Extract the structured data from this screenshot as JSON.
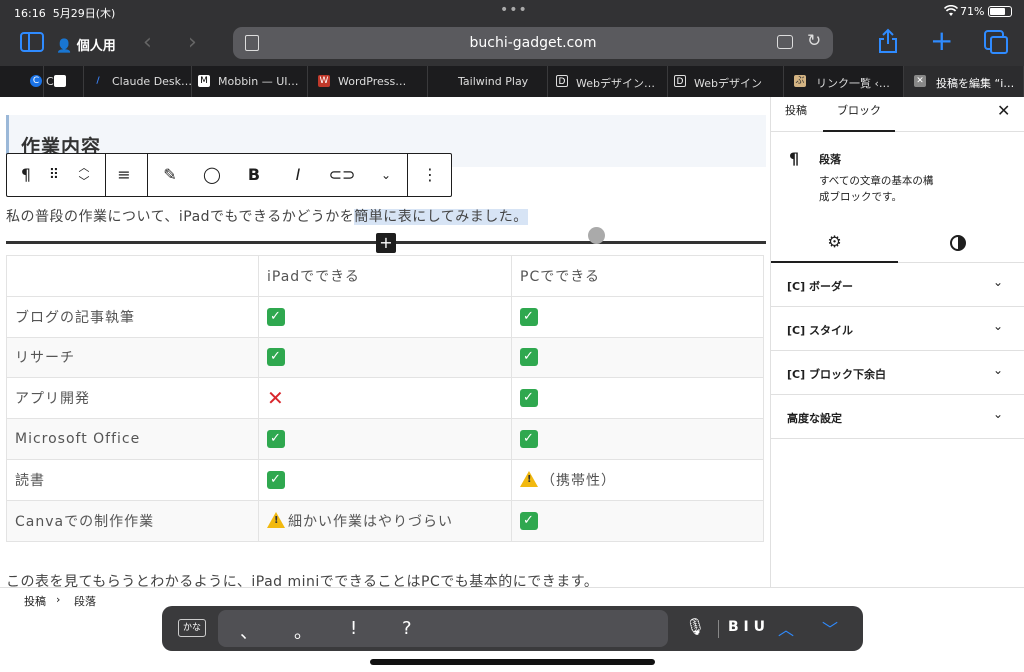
{
  "status": {
    "time": "16:16",
    "date": "5月29日(木)",
    "battery": "71%"
  },
  "toolbar": {
    "profile": "個人用",
    "url": "buchi-gadget.com"
  },
  "tabs": [
    {
      "label": "C",
      "fav": "C",
      "fav_color": "#1a73e8"
    },
    {
      "label": "",
      "fav": "",
      "fav_color": "#ffffff"
    },
    {
      "label": "Claude Desk…",
      "fav": "/",
      "fav_color": "#3b82f6"
    },
    {
      "label": "Mobbin — UI…",
      "fav": "M",
      "fav_color": "#ffffff"
    },
    {
      "label": "WordPress…",
      "fav": "W",
      "fav_color": "#c0392b"
    },
    {
      "label": "Tailwind Play",
      "fav": "",
      "fav_color": "#1c1c1e"
    },
    {
      "label": "Webデザイン…",
      "fav": "D",
      "fav_color": "#1c1c1e"
    },
    {
      "label": "Webデザイン",
      "fav": "D",
      "fav_color": "#1c1c1e"
    },
    {
      "label": "リンク一覧 ‹…",
      "fav": "ぶ",
      "fav_color": "#d4b483"
    },
    {
      "label": "投稿を編集 “i…",
      "fav": "✕",
      "fav_color": "#888888"
    }
  ],
  "editor": {
    "heading": "作業内容",
    "para_before": "私の普段の作業について、iPadでもできるかどうかを",
    "para_highlight": "簡単に表にしてみました。",
    "table": {
      "headers": [
        "",
        "iPadでできる",
        "PCでできる"
      ],
      "rows": [
        {
          "task": "ブログの記事執筆",
          "ipad": "ok",
          "pc": "ok",
          "ipad_text": "",
          "pc_text": ""
        },
        {
          "task": "リサーチ",
          "ipad": "ok",
          "pc": "ok",
          "ipad_text": "",
          "pc_text": ""
        },
        {
          "task": "アプリ開発",
          "ipad": "ng",
          "pc": "ok",
          "ipad_text": "",
          "pc_text": ""
        },
        {
          "task": "Microsoft Office",
          "ipad": "ok",
          "pc": "ok",
          "ipad_text": "",
          "pc_text": ""
        },
        {
          "task": "読書",
          "ipad": "ok",
          "pc": "warn",
          "ipad_text": "",
          "pc_text": "（携帯性）"
        },
        {
          "task": "Canvaでの制作作業",
          "ipad": "warn",
          "pc": "ok",
          "ipad_text": "細かい作業はやりづらい",
          "pc_text": ""
        }
      ]
    },
    "para2": "この表を見てもらうとわかるように、iPad miniでできることはPCでも基本的にできます。"
  },
  "breadcrumb": {
    "root": "投稿",
    "sep": "›",
    "current": "段落"
  },
  "sidebar": {
    "tab_post": "投稿",
    "tab_block": "ブロック",
    "block_name": "段落",
    "block_desc": "すべての文章の基本の構成ブロックです。",
    "panels": [
      "[C] ボーダー",
      "[C] スタイル",
      "[C] ブロック下余白",
      "高度な設定"
    ]
  },
  "keyboard": {
    "kana": "かな",
    "candidates": [
      "、",
      "。",
      "!",
      "?"
    ],
    "format": "B I U"
  }
}
